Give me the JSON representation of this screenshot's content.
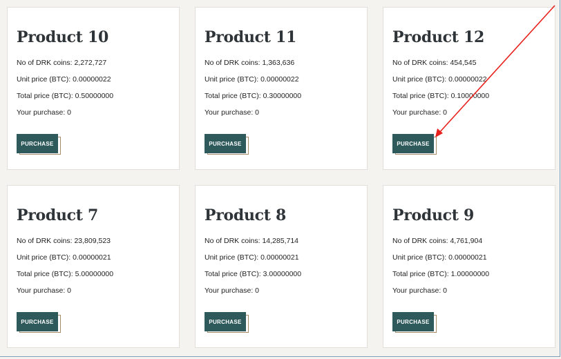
{
  "labels": {
    "coins": "No of DRK coins: ",
    "unit": "Unit price (BTC): ",
    "total": "Total price (BTC): ",
    "purchase": "Your purchase: ",
    "button": "PURCHASE"
  },
  "products": [
    {
      "title": "Product 10",
      "coins": "2,272,727",
      "unit": "0.00000022",
      "total": "0.50000000",
      "purchase": "0"
    },
    {
      "title": "Product 11",
      "coins": "1,363,636",
      "unit": "0.00000022",
      "total": "0.30000000",
      "purchase": "0"
    },
    {
      "title": "Product 12",
      "coins": "454,545",
      "unit": "0.00000022",
      "total": "0.10000000",
      "purchase": "0"
    },
    {
      "title": "Product 7",
      "coins": "23,809,523",
      "unit": "0.00000021",
      "total": "5.00000000",
      "purchase": "0"
    },
    {
      "title": "Product 8",
      "coins": "14,285,714",
      "unit": "0.00000021",
      "total": "3.00000000",
      "purchase": "0"
    },
    {
      "title": "Product 9",
      "coins": "4,761,904",
      "unit": "0.00000021",
      "total": "1.00000000",
      "purchase": "0"
    }
  ],
  "colors": {
    "background": "#f5f3ef",
    "button": "#2f5a5c",
    "button_outline": "#a68a6a",
    "annotation_arrow": "#e8201c"
  }
}
